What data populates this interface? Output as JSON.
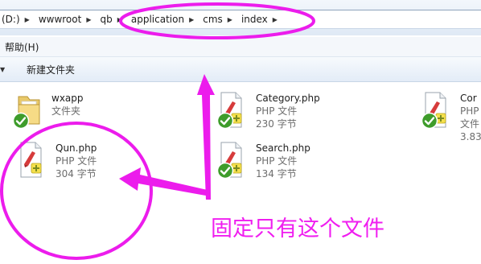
{
  "address_bar": {
    "crumbs": [
      "(D:)",
      "wwwroot",
      "qb",
      "application",
      "cms",
      "index"
    ]
  },
  "menubar": {
    "help": "帮助(H)"
  },
  "toolbar": {
    "new_folder": "新建文件夹"
  },
  "files": [
    {
      "name": "wxapp",
      "type": "文件夹",
      "size": "",
      "icon": "folder-icon"
    },
    {
      "name": "Category.php",
      "type": "PHP 文件",
      "size": "230 字节",
      "icon": "php-file-icon"
    },
    {
      "name": "Cor",
      "type": "PHP 文件",
      "size": "3.83",
      "icon": "php-file-icon"
    },
    {
      "name": "Qun.php",
      "type": "PHP 文件",
      "size": "304 字节",
      "icon": "php-file-icon"
    },
    {
      "name": "Search.php",
      "type": "PHP 文件",
      "size": "134 字节",
      "icon": "php-file-icon"
    }
  ],
  "annotation": {
    "text": "固定只有这个文件",
    "color": "#f01ef0"
  }
}
